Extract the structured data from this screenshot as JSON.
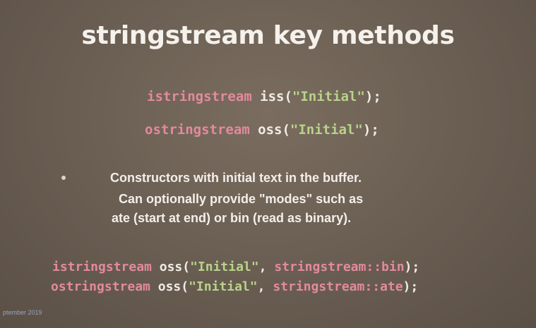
{
  "slide": {
    "title": "stringstream key methods",
    "code_top": [
      {
        "type": "istringstream",
        "rest": " iss(",
        "string": "\"Initial\"",
        "end": ");"
      },
      {
        "type": "ostringstream",
        "rest": " oss(",
        "string": "\"Initial\"",
        "end": ");"
      }
    ],
    "bullet": {
      "line1": "Constructors with initial text in the buffer.",
      "line2": "Can optionally provide \"modes\" such as",
      "line3": "ate (start at end) or bin (read as binary)."
    },
    "code_bottom": [
      {
        "type": "istringstream",
        "rest": " oss(",
        "string": "\"Initial\"",
        "mid": ", ",
        "scope": "stringstream::bin",
        "end": ");"
      },
      {
        "type": "ostringstream",
        "rest": " oss(",
        "string": "\"Initial\"",
        "mid": ", ",
        "scope": "stringstream::ate",
        "end": ");"
      }
    ],
    "footer": "ptember 2019"
  },
  "colors": {
    "background": "#6c6054",
    "title": "#f5f1ec",
    "keyword": "#e38a9c",
    "string": "#b8d38a",
    "plain": "#f1ece6"
  }
}
